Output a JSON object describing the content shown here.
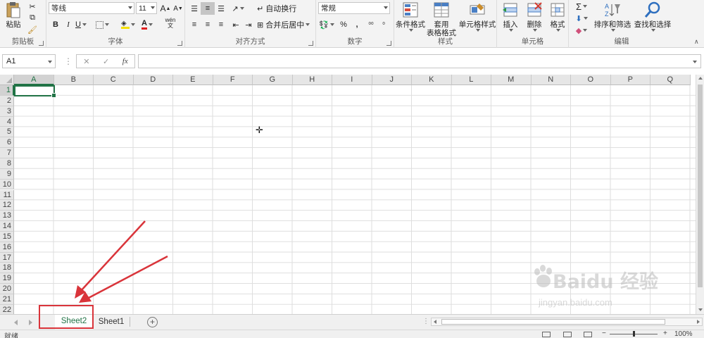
{
  "ribbon": {
    "clipboard": {
      "paste_label": "粘贴",
      "group_label": "剪贴板"
    },
    "font": {
      "name": "等线",
      "size": "11",
      "grow_label": "A",
      "shrink_label": "A",
      "bold": "B",
      "italic": "I",
      "underline": "U",
      "phonetic_label": "wén",
      "group_label": "字体"
    },
    "alignment": {
      "wrap_text_label": "自动换行",
      "merge_center_label": "合并后居中",
      "group_label": "对齐方式"
    },
    "number": {
      "format": "常规",
      "percent": "%",
      "comma": ",",
      "group_label": "数字"
    },
    "styles": {
      "conditional_label": "条件格式",
      "table_label_1": "套用",
      "table_label_2": "表格格式",
      "cell_styles_label": "单元格样式",
      "group_label": "样式"
    },
    "cells": {
      "insert_label": "插入",
      "delete_label": "删除",
      "format_label": "格式",
      "group_label": "单元格"
    },
    "editing": {
      "sort_filter_label": "排序和筛选",
      "find_select_label": "查找和选择",
      "group_label": "编辑"
    }
  },
  "formula_bar": {
    "name_box": "A1",
    "cancel": "✕",
    "enter": "✓",
    "fx": "fx",
    "value": ""
  },
  "grid": {
    "columns": [
      "A",
      "B",
      "C",
      "D",
      "E",
      "F",
      "G",
      "H",
      "I",
      "J",
      "K",
      "L",
      "M",
      "N",
      "O",
      "P",
      "Q"
    ],
    "rows": [
      "1",
      "2",
      "3",
      "4",
      "5",
      "6",
      "7",
      "8",
      "9",
      "10",
      "11",
      "12",
      "13",
      "14",
      "15",
      "16",
      "17",
      "18",
      "19",
      "20",
      "21",
      "22"
    ],
    "active_cell": "A1"
  },
  "sheets": {
    "tabs": [
      "Sheet2",
      "Sheet1"
    ],
    "active": "Sheet2",
    "add_label": "+"
  },
  "status": {
    "ready": "就绪",
    "zoom": "100%"
  },
  "watermark": {
    "brand": "Baidu 经验",
    "url": "jingyan.baidu.com"
  },
  "colors": {
    "excel_green": "#217346",
    "annotation_red": "#d9343a"
  }
}
